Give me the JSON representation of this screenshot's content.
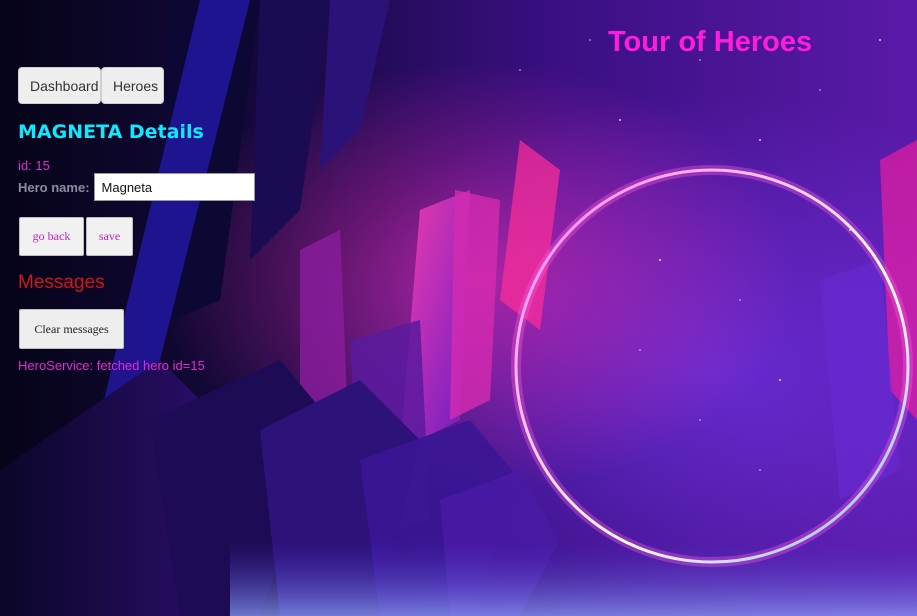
{
  "app": {
    "title": "Tour of Heroes"
  },
  "nav": {
    "items": [
      {
        "label": "Dashboard"
      },
      {
        "label": "Heroes"
      }
    ]
  },
  "hero": {
    "details_title": "MAGNETA Details",
    "id_text": "id: 15",
    "name_label": "Hero name:",
    "name_value": "Magneta"
  },
  "actions": {
    "go_back": "go back",
    "save": "save"
  },
  "messages": {
    "title": "Messages",
    "clear_label": "Clear messages",
    "items": [
      "HeroService: fetched hero id=15"
    ]
  },
  "colors": {
    "title": "#ff1cdc",
    "details_title": "#10e8ff",
    "text_accent": "#e22ad4",
    "messages_title": "#d0151b"
  }
}
